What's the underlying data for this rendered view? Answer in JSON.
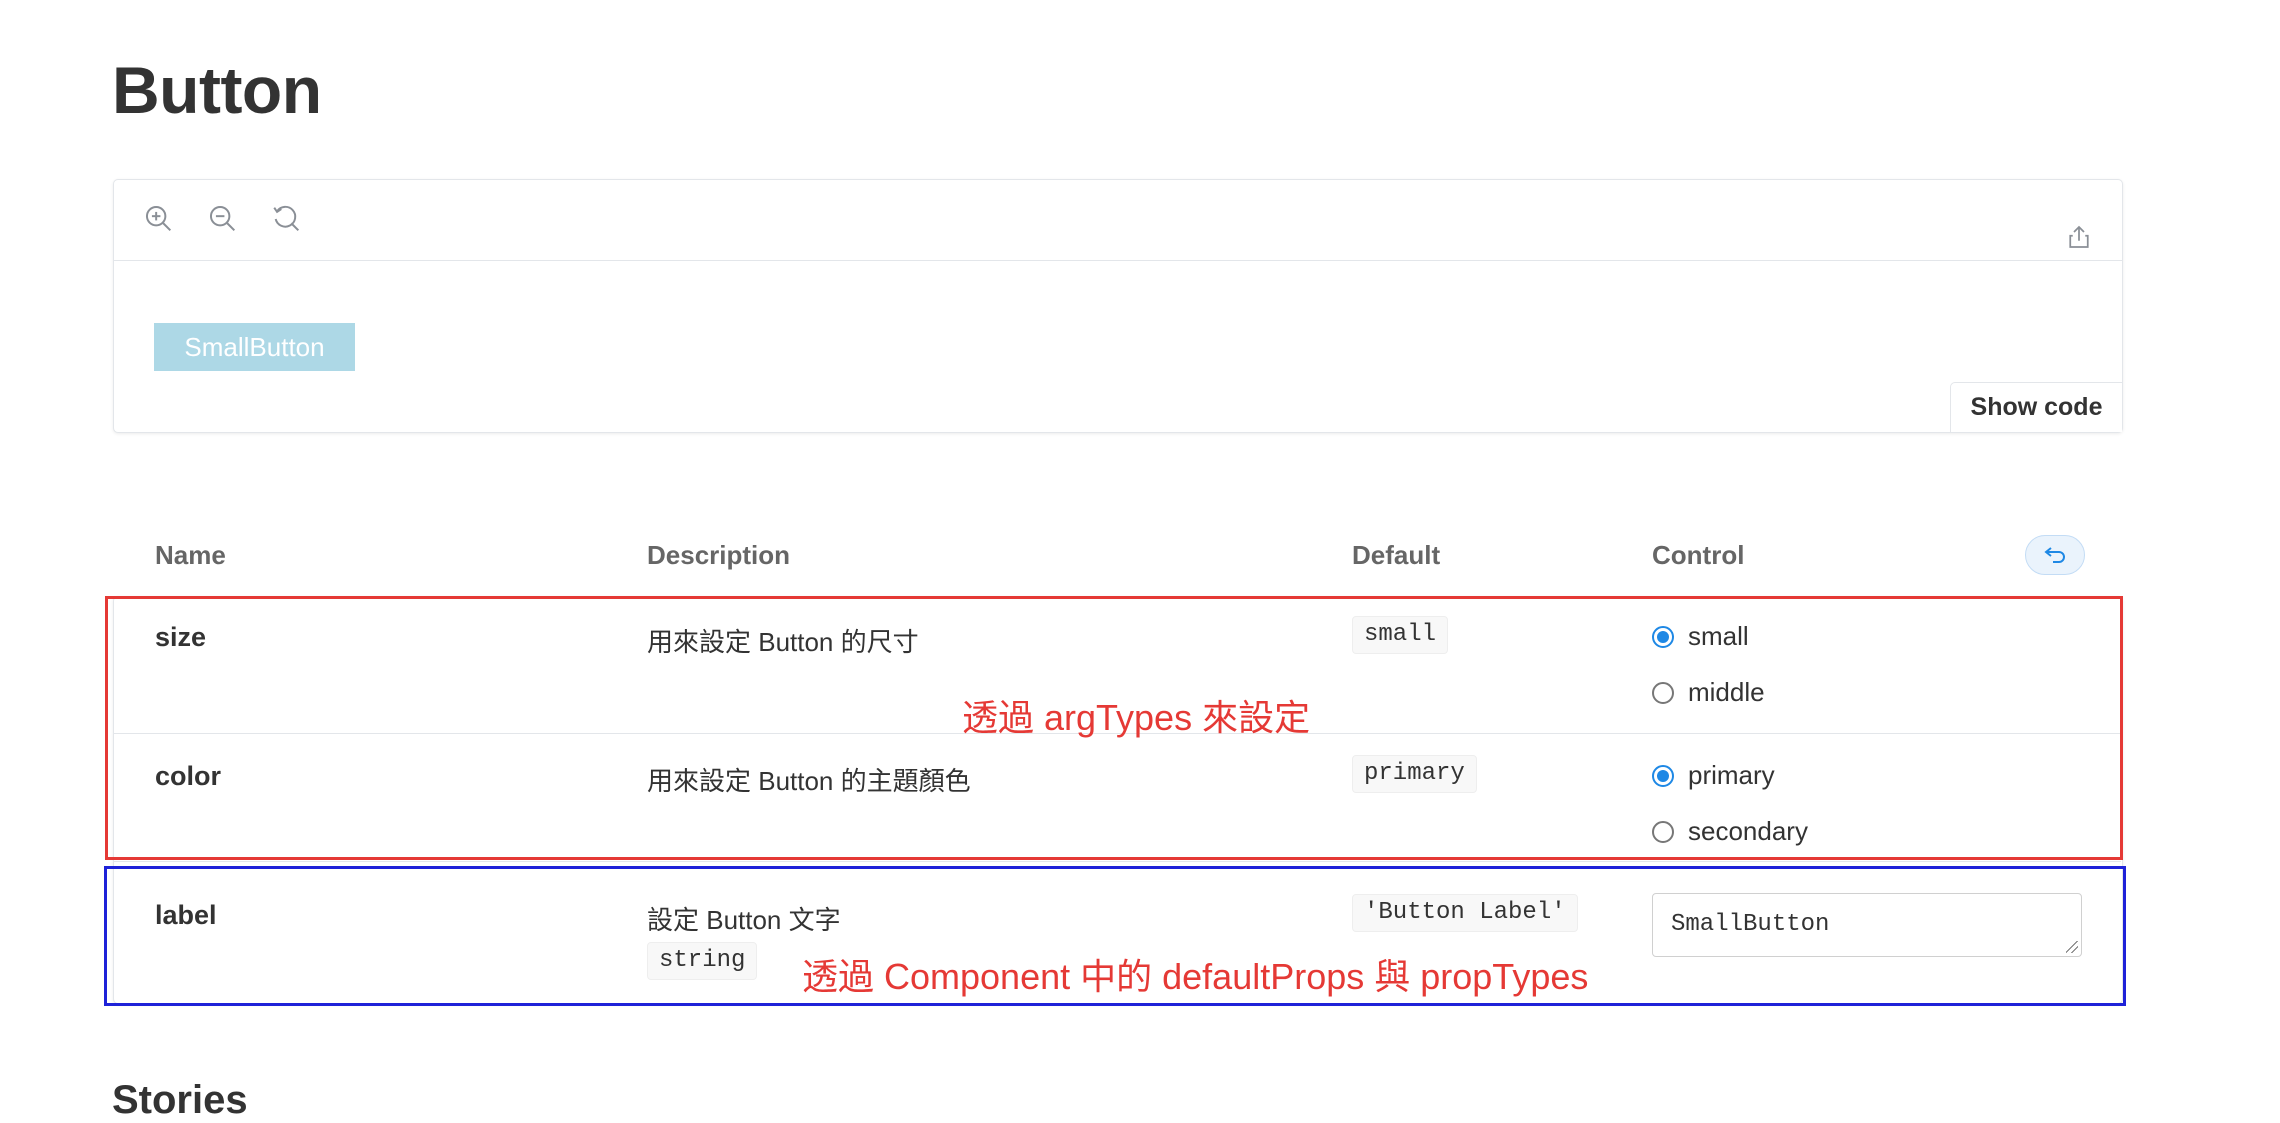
{
  "page": {
    "title": "Button",
    "next_section_title": "Stories"
  },
  "canvas": {
    "toolbar": {
      "zoom_in_icon": "zoom-in-icon",
      "zoom_out_icon": "zoom-out-icon",
      "reset_zoom_icon": "reset-zoom-icon",
      "share_icon": "share-icon"
    },
    "preview_button_label": "SmallButton",
    "preview_button_color": "#add8e6",
    "show_code_label": "Show code"
  },
  "args_table": {
    "headers": {
      "name": "Name",
      "description": "Description",
      "default": "Default",
      "control": "Control"
    },
    "reset_icon": "undo-icon",
    "rows": [
      {
        "name": "size",
        "description": "用來設定 Button 的尺寸",
        "default": "small",
        "options": [
          {
            "label": "small",
            "checked": true
          },
          {
            "label": "middle",
            "checked": false
          }
        ]
      },
      {
        "name": "color",
        "description": "用來設定 Button 的主題顏色",
        "default": "primary",
        "options": [
          {
            "label": "primary",
            "checked": true
          },
          {
            "label": "secondary",
            "checked": false
          }
        ]
      },
      {
        "name": "label",
        "description": "設定 Button 文字",
        "type": "string",
        "default": "'Button Label'",
        "control_value": "SmallButton"
      }
    ]
  },
  "annotations": {
    "red_box_text": "透過 argTypes 來設定",
    "blue_box_text": "透過 Component 中的 defaultProps 與 propTypes",
    "red_color": "#e53935",
    "blue_color": "#1e22d8"
  }
}
